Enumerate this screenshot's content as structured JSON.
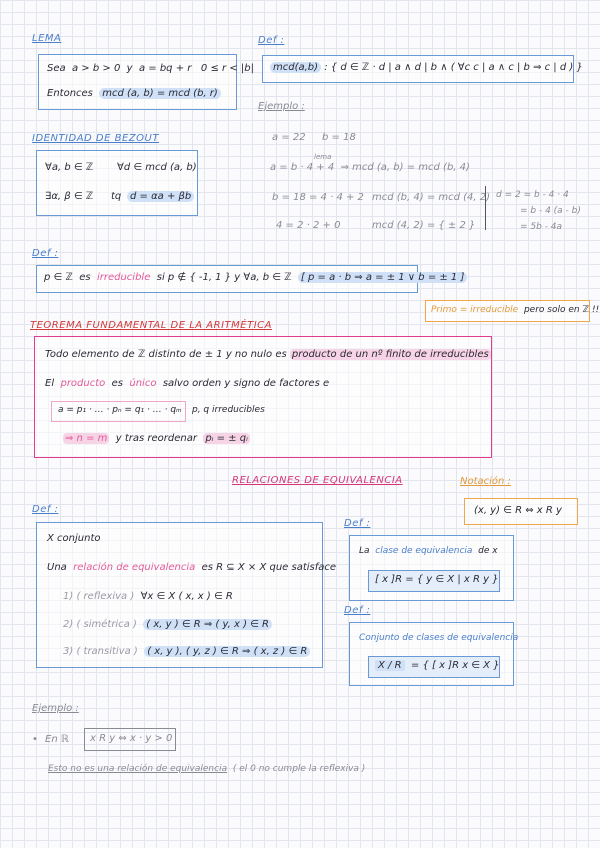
{
  "lema": {
    "title": "LEMA",
    "line1_a": "Sea",
    "line1_b": "a > b > 0",
    "line1_c": "y",
    "line1_d": "a = bq + r",
    "line1_e": "0 ≤ r < |b|",
    "line2_a": "Entonces",
    "line2_b": "mcd (a, b) = mcd (b, r)"
  },
  "def_mcd": {
    "title": "Def :",
    "formula_a": "mcd(a,b)",
    "formula_b": ": { d ∈ ℤ · d | a  ∧  d | b  ∧ ( ∀c  c | a ∧ c | b  ⇒ c | d ) }"
  },
  "ejemplo1": {
    "title": "Ejemplo :",
    "a": "a = 22",
    "b": "b = 18",
    "lema_note": "lema",
    "step1_a": "a = b · 4 + 4",
    "step1_b": "⇒  mcd (a, b) = mcd (b, 4)",
    "step2_a": "b = 18 = 4 · 4 + 2",
    "step2_b": "mcd (b, 4) = mcd (4, 2)",
    "step3_a": "4 = 2 · 2 + 0",
    "step3_b": "mcd (4, 2) = { ± 2 }",
    "side1": "d = 2 = b - 4 · 4",
    "side2": "= b - 4 (a - b)",
    "side3": "= 5b - 4a"
  },
  "bezout": {
    "title": "IDENTIDAD DE BEZOUT",
    "row1_a": "∀a, b ∈ ℤ",
    "row1_b": "∀d ∈ mcd (a, b)",
    "row2_a": "∃α, β ∈ ℤ",
    "row2_b": "tq",
    "row2_c": "d = αa + βb"
  },
  "def_irreducible": {
    "title": "Def :",
    "text_a": "p ∈ ℤ",
    "text_b": "es",
    "text_c": "irreducible",
    "text_d": "si  p ∉ { -1, 1 }  y  ∀a, b ∈ ℤ",
    "text_e": "[ p = a · b  ⇒  a = ± 1   ∨  b = ± 1 ]"
  },
  "primo_note": {
    "a": "Primo = irreducible",
    "b": "pero solo en ℤ !!!"
  },
  "teorema": {
    "title": "TEOREMA FUNDAMENTAL DE LA ARITMÉTICA",
    "line1_a": "Todo elemento de ℤ distinto de ± 1 y no nulo es",
    "line1_b": "producto de un nº finito de irreducibles",
    "line2_a": "El",
    "line2_b": "producto",
    "line2_c": "es",
    "line2_d": "único",
    "line2_e": "salvo orden y signo de factores e",
    "formula": "a = p₁ · … · pₙ = q₁ · … · qₘ",
    "formula_note": "p, q irreducibles",
    "conclusion_a": "⇒ n = m",
    "conclusion_b": "y tras reordenar",
    "conclusion_c": "pᵢ = ± qᵢ"
  },
  "relaciones": {
    "title": "RELACIONES DE EQUIVALENCIA",
    "notacion_title": "Notación :",
    "notacion": "(x, y) ∈ R  ⇔  x R y"
  },
  "def_relacion": {
    "title": "Def :",
    "line1": "X conjunto",
    "line2_a": "Una",
    "line2_b": "relación de equivalencia",
    "line2_c": "es  R ⊆ X × X  que satisface",
    "p1_a": "1) ( reflexiva )",
    "p1_b": "∀x ∈ X   ( x, x ) ∈ R",
    "p2_a": "2) ( simétrica )",
    "p2_b": "( x, y ) ∈ R  ⇒  ( y, x ) ∈ R",
    "p3_a": "3) ( transitiva )",
    "p3_b": "( x, y ), ( y, z ) ∈ R  ⇒  ( x, z ) ∈ R"
  },
  "def_clase": {
    "title": "Def :",
    "text_a": "La",
    "text_b": "clase de equivalencia",
    "text_c": "de x",
    "formula": "[ x ]R = { y ∈ X  |  x R y }"
  },
  "def_cociente": {
    "title": "Def :",
    "text": "Conjunto de clases de equivalencia",
    "formula_a": "X / R",
    "formula_b": "= { [ x ]R   x ∈ X }"
  },
  "ejemplo2": {
    "title": "Ejemplo :",
    "bullet": "•",
    "line1_a": "En ℝ",
    "line1_b": "x R y  ⇔  x · y > 0",
    "line2_a": "Esto no es una relación de equivalencia",
    "line2_b": "( el 0 no cumple la reflexiva )"
  }
}
